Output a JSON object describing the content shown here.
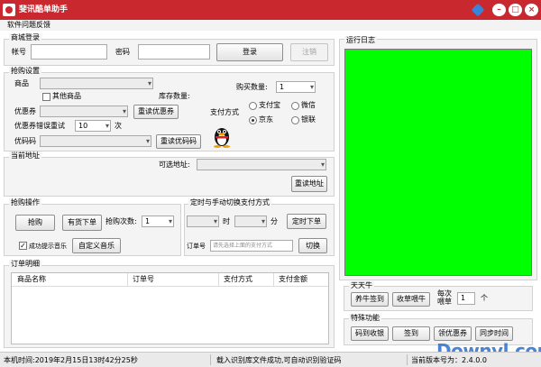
{
  "titlebar": {
    "title": "斐讯酷单助手",
    "minimize_label": "–",
    "maximize_label": "□",
    "close_label": "×"
  },
  "menu": {
    "feedback": "软件问题反馈"
  },
  "login": {
    "legend": "商城登录",
    "account_label": "帐号",
    "password_label": "密码",
    "login_button": "登录",
    "logout_button": "注销"
  },
  "purchase": {
    "legend": "抢购设置",
    "product_label": "商品",
    "other_product_label": "其他商品",
    "stock_label": "库存数量:",
    "buy_qty_label": "购买数量:",
    "buy_qty_value": "1",
    "coupon_label": "优惠券",
    "reload_coupon_button": "重读优惠券",
    "payment_label": "支付方式",
    "payment_options": [
      "支付宝",
      "微信",
      "京东",
      "银联"
    ],
    "payment_selected": "京东",
    "coupon_retry_label": "优惠券错误重试",
    "retry_value": "10",
    "retry_unit": "次",
    "promo_code_label": "优码码",
    "reload_code_button": "重读优码码"
  },
  "address": {
    "legend": "当前地址",
    "optional_label": "可选地址:",
    "reload_address_button": "重读地址"
  },
  "operation": {
    "legend": "抢购操作",
    "buy_button": "抢购",
    "order_in_stock_button": "有货下单",
    "attempts_label": "抢购次数:",
    "attempts_value": "1",
    "success_music_label": "成功提示音乐",
    "custom_music_button": "自定义音乐"
  },
  "timed": {
    "legend": "定时与手动切换支付方式",
    "hour_label": "时",
    "minute_label": "分",
    "timed_order_button": "定时下单",
    "order_no_label": "订单号",
    "order_no_placeholder": "请先选择上面的支付方式",
    "switch_button": "切换"
  },
  "orders": {
    "legend": "订单明细",
    "columns": [
      "商品名称",
      "订单号",
      "支付方式",
      "支付金额"
    ]
  },
  "log": {
    "legend": "运行日志"
  },
  "tiantianniu": {
    "legend": "天天牛",
    "sign_in_button": "养牛签到",
    "collect_button": "收草喂牛",
    "times_label_1": "每次",
    "times_label_2": "喂草",
    "times_value": "1",
    "times_unit": "个"
  },
  "special": {
    "legend": "特殊功能",
    "code_to_receipt_button": "码到收银",
    "sign_button": "签到",
    "coupon_button": "领优惠券",
    "sync_time_button": "同步时间"
  },
  "status": {
    "local_time": "本机时间:2019年2月15日13时42分25秒",
    "message": "载入识别库文件成功,可自动识别验证码",
    "version": "当前版本号为：2.4.0.0"
  },
  "watermark": "Downyl.com",
  "colors": {
    "titlebar": "#c8282e",
    "log_background": "#00ff00",
    "watermark": "#2a6fd0"
  }
}
